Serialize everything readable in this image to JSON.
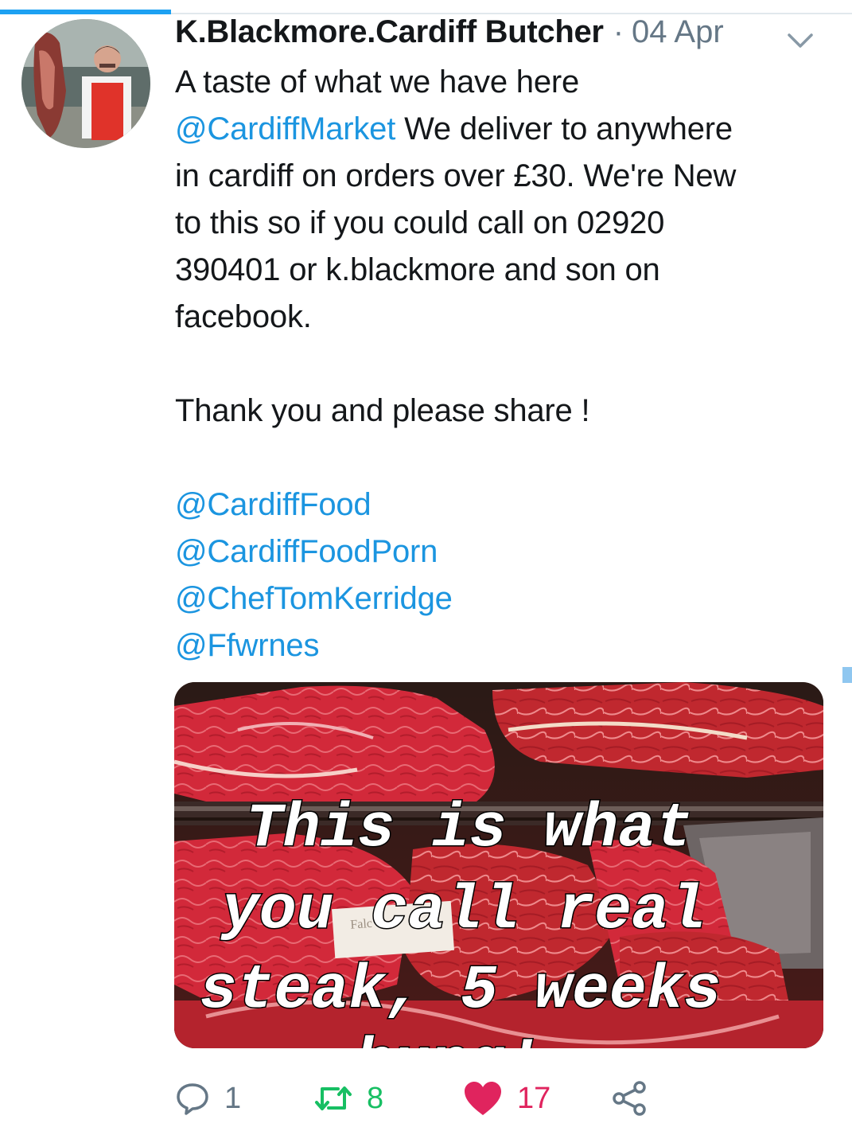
{
  "tweet": {
    "author_name": "K.Blackmore.Cardiff Butcher",
    "separator": "·",
    "timestamp": "04 Apr",
    "text_lines": [
      {
        "plain": "A taste of what we have here",
        "mention": ""
      },
      {
        "mention": "@CardiffMarket",
        "plain": " We deliver to anywhere"
      },
      {
        "plain": "in cardiff on orders over £30. We're New",
        "mention": ""
      },
      {
        "plain": "to this so if you could call on 02920",
        "mention": ""
      },
      {
        "plain": "390401 or k.blackmore and son on",
        "mention": ""
      },
      {
        "plain": "facebook.",
        "mention": ""
      }
    ],
    "closing_line": "Thank you and please share !",
    "mentions": [
      "@CardiffFood",
      "@CardiffFoodPorn",
      "@ChefTomKerridge",
      "@Ffwrnes"
    ]
  },
  "media": {
    "caption_lines": [
      "This is what",
      "you call real",
      "steak, 5 weeks",
      "hung!"
    ],
    "label_card": "Falc"
  },
  "actions": {
    "reply_count": "1",
    "retweet_count": "8",
    "like_count": "17"
  },
  "icons": {
    "caret": "chevron-down-icon",
    "reply": "speech-bubble-icon",
    "retweet": "retweet-arrows-icon",
    "like": "heart-icon",
    "share": "share-nodes-icon"
  },
  "colors": {
    "link": "#1b95e0",
    "text": "#14171a",
    "muted": "#657786",
    "retweet": "#17bf63",
    "like": "#e0245e",
    "accent": "#1da1f2"
  }
}
